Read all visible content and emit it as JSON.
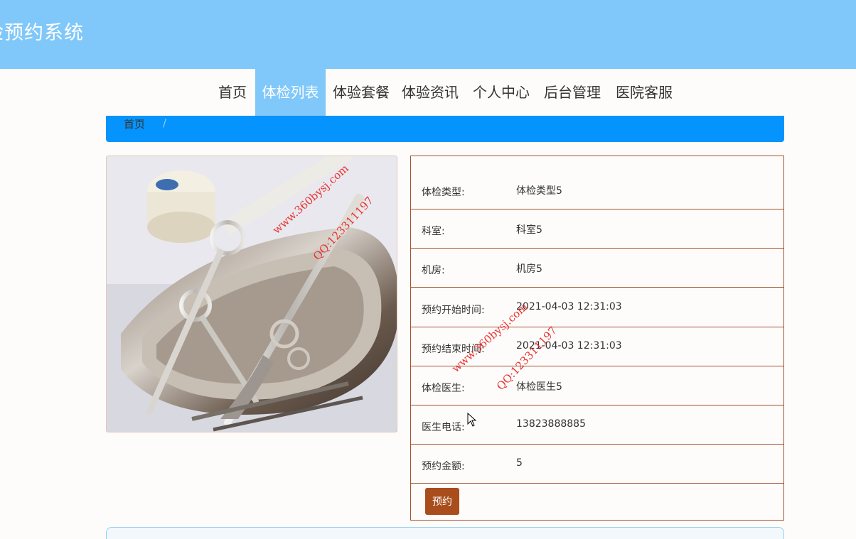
{
  "header": {
    "site_title": "检预约系统"
  },
  "nav": {
    "items": [
      {
        "label": "首页"
      },
      {
        "label": "体检列表"
      },
      {
        "label": "体验套餐"
      },
      {
        "label": "体验资讯"
      },
      {
        "label": "个人中心"
      },
      {
        "label": "后台管理"
      },
      {
        "label": "医院客服"
      }
    ],
    "active_index": 1
  },
  "breadcrumb": {
    "home": "首页",
    "separator": "/"
  },
  "details": {
    "rows": [
      {
        "label": "体检类型:",
        "value": "体检类型5"
      },
      {
        "label": "科室:",
        "value": "科室5"
      },
      {
        "label": "机房:",
        "value": "机房5"
      },
      {
        "label": "预约开始时间:",
        "value": "2021-04-03 12:31:03"
      },
      {
        "label": "预约结束时间:",
        "value": "2021-04-03 12:31:03"
      },
      {
        "label": "体检医生:",
        "value": "体检医生5"
      },
      {
        "label": "医生电话:",
        "value": "13823888885"
      },
      {
        "label": "预约金额:",
        "value": "5"
      }
    ],
    "book_button": "预约"
  },
  "watermarks": {
    "site": "www.360bysj.com",
    "qq": "QQ:123311197"
  },
  "colors": {
    "header_bg": "#80c8fa",
    "breadcrumb_bg": "#0594fd",
    "table_border": "#a0522d",
    "button_bg": "#a84d1b",
    "watermark": "#e8322f"
  }
}
